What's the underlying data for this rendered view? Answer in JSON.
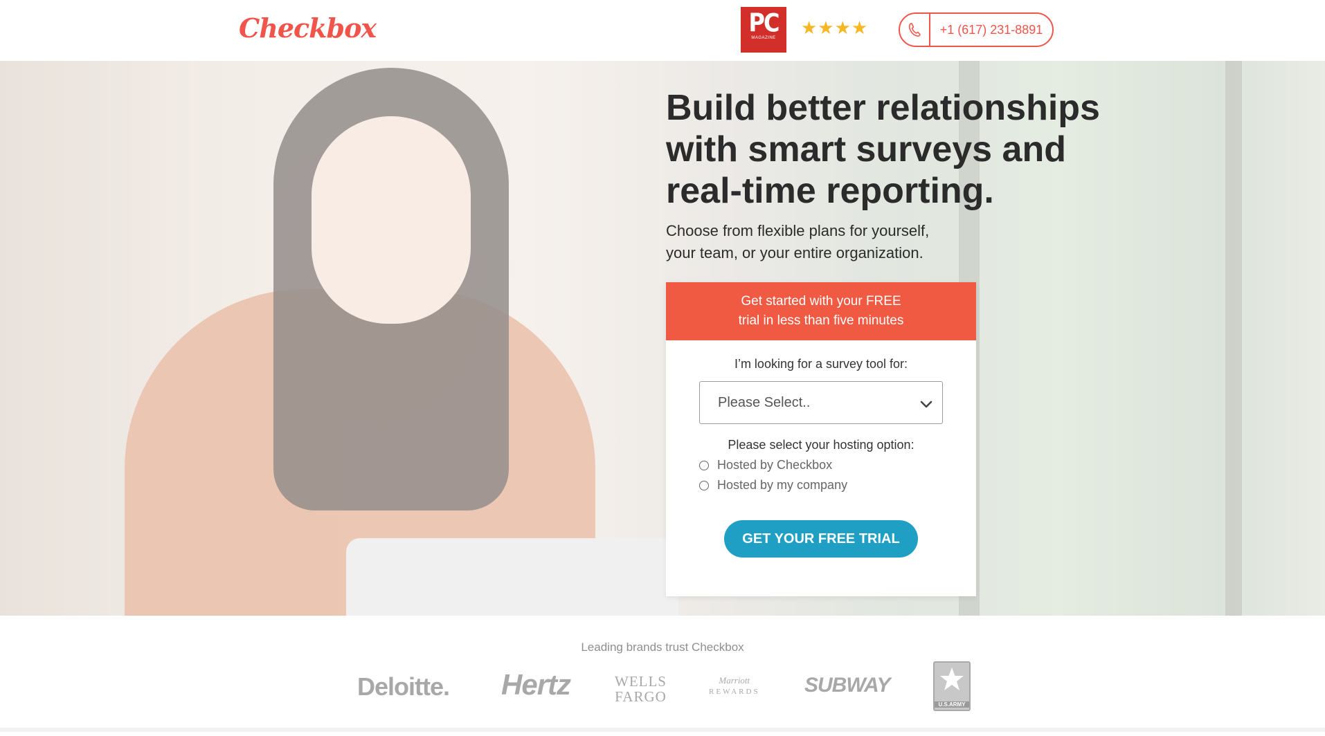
{
  "header": {
    "logo": "Checkbox",
    "badge_pc": "PC",
    "badge_magazine": "MAGAZINE",
    "stars": "★★★★",
    "rating_stars": 4,
    "phone": "+1 (617) 231-8891"
  },
  "hero": {
    "headline": "Build better relationships with smart surveys and real-time reporting.",
    "subhead": "Choose from flexible plans for yourself, your team, or your entire organization."
  },
  "form": {
    "header_line1": "Get started with your FREE",
    "header_line2": "trial in less than five minutes",
    "survey_label": "I’m looking for a survey tool for:",
    "survey_select_value": "Please Select..",
    "hosting_label": "Please select your hosting option:",
    "hosting_options": [
      "Hosted by Checkbox",
      "Hosted by my company"
    ],
    "cta": "GET YOUR FREE TRIAL"
  },
  "trust": {
    "label": "Leading brands trust Checkbox",
    "brands": {
      "deloitte": "Deloitte.",
      "hertz": "Hertz",
      "wells_line1": "WELLS",
      "wells_line2": "FARGO",
      "marriott_line1": "Marriott",
      "marriott_line2": "REWARDS",
      "subway": "SUBWAY",
      "army_tag": "U.S.ARMY"
    }
  },
  "colors": {
    "brand_red": "#f1544a",
    "form_header": "#f15a42",
    "cta_blue": "#1f9fc3",
    "star_gold": "#f5b823"
  }
}
